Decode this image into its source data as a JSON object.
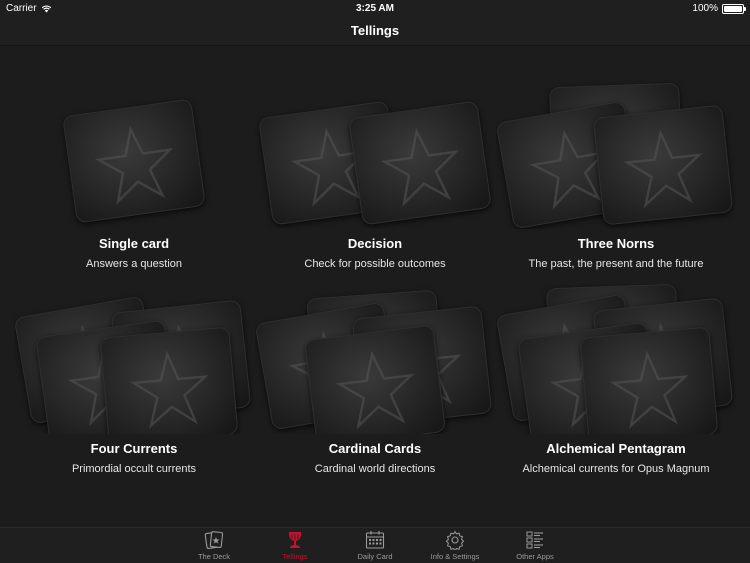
{
  "status": {
    "carrier": "Carrier",
    "time": "3:25 AM",
    "battery": "100%",
    "battery_level": 1.0
  },
  "nav": {
    "title": "Tellings"
  },
  "tellings": [
    {
      "title": "Single card",
      "subtitle": "Answers a question"
    },
    {
      "title": "Decision",
      "subtitle": "Check for possible outcomes"
    },
    {
      "title": "Three Norns",
      "subtitle": "The past, the present and the future"
    },
    {
      "title": "Four Currents",
      "subtitle": "Primordial occult currents"
    },
    {
      "title": "Cardinal Cards",
      "subtitle": "Cardinal world directions"
    },
    {
      "title": "Alchemical Pentagram",
      "subtitle": "Alchemical currents for Opus Magnum"
    }
  ],
  "tabs": [
    {
      "label": "The Deck",
      "icon": "card-deck-icon",
      "active": false
    },
    {
      "label": "Tellings",
      "icon": "chalice-icon",
      "active": true
    },
    {
      "label": "Daily Card",
      "icon": "calendar-icon",
      "active": false
    },
    {
      "label": "Info & Settings",
      "icon": "gear-icon",
      "active": false
    },
    {
      "label": "Other Apps",
      "icon": "list-icon",
      "active": false
    }
  ],
  "colors": {
    "active_tab": "#c8102e",
    "inactive_tab": "#9a9a9a",
    "background": "#1c1c1c"
  }
}
